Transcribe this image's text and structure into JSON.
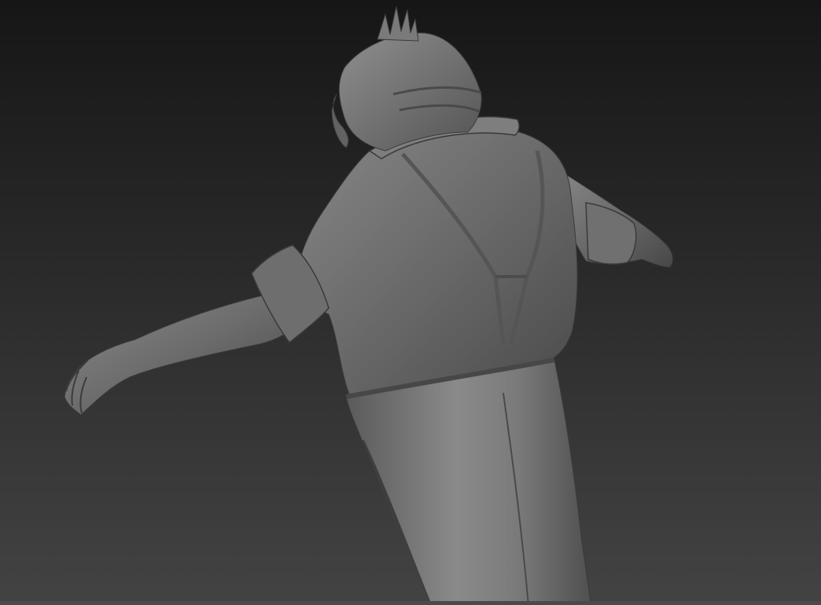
{
  "viewport": {
    "background_gradient": [
      "#171717",
      "#424242"
    ],
    "model": {
      "name_icon": "sculpt-character-mesh",
      "material_color": "#6f6f6f",
      "highlight_color": "#8c8c8c",
      "shadow_color": "#3e3e3e"
    },
    "bottom_strip_color": "#4a4a4a"
  }
}
